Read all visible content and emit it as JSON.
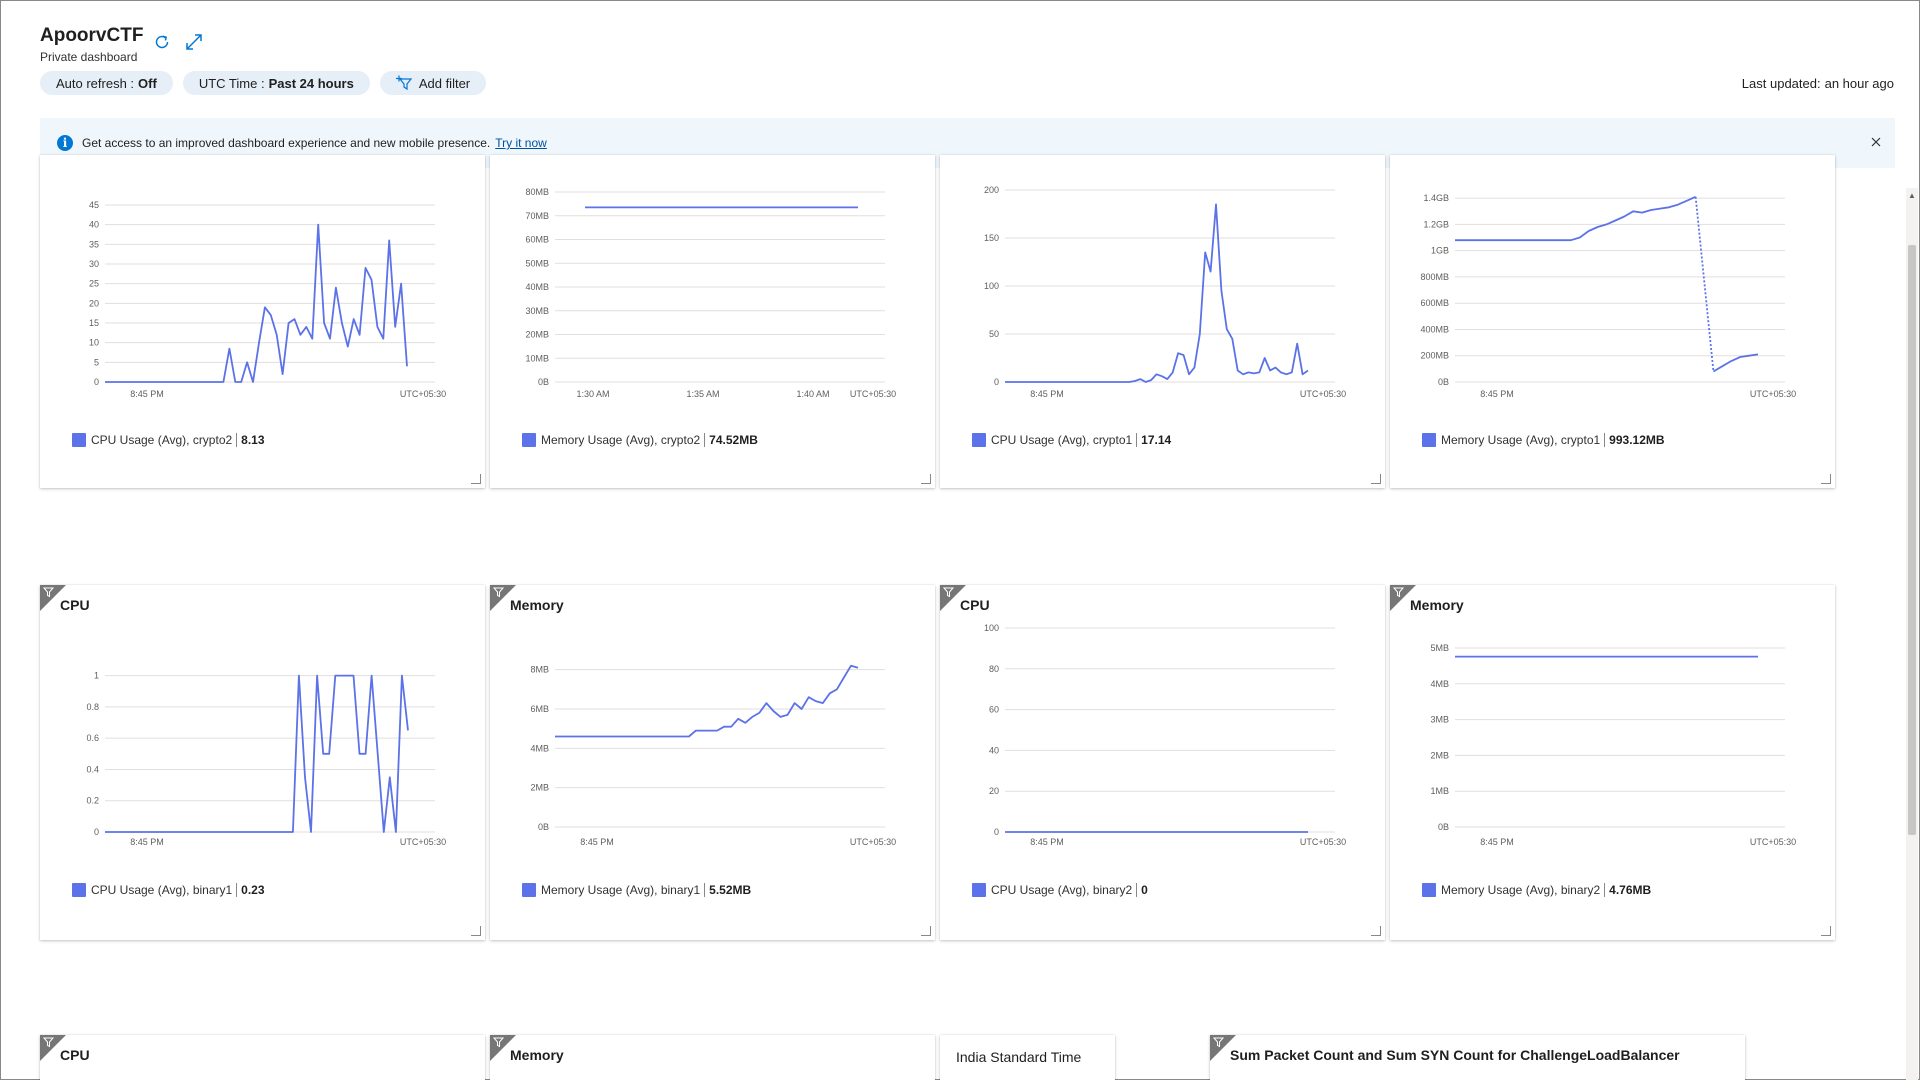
{
  "header": {
    "title": "ApoorvCTF",
    "subtitle": "Private dashboard",
    "refresh_icon": "refresh-icon",
    "expand_icon": "expand-icon",
    "auto_refresh_label": "Auto refresh :",
    "auto_refresh_value": "Off",
    "time_label": "UTC Time :",
    "time_value": "Past 24 hours",
    "add_filter_label": "Add filter",
    "last_updated_label": "Last updated:",
    "last_updated_value": "an hour ago"
  },
  "banner": {
    "icon": "info-icon",
    "message": "Get access to an improved dashboard experience and new mobile presence.",
    "link": "Try it now",
    "close_icon": "close-icon"
  },
  "colors": {
    "series": "#5b72e8",
    "accent": "#0078d4",
    "banner_bg": "#eff6fc",
    "pill_bg": "#e6eef8"
  },
  "tiles": [
    {
      "id": "t1",
      "title": "",
      "has_flag": false,
      "legend_label": "CPU Usage (Avg), crypto2",
      "legend_value": "8.13",
      "chart_data": {
        "type": "line",
        "y_ticks": [
          "0",
          "5",
          "10",
          "15",
          "20",
          "25",
          "30",
          "35",
          "40",
          "45"
        ],
        "ylim": [
          0,
          45
        ],
        "x_ticks": [
          "8:45 PM"
        ],
        "x_right_label": "UTC+05:30",
        "values": [
          0,
          0,
          0,
          0,
          0,
          0,
          0,
          0,
          0,
          0,
          0,
          0,
          0,
          0,
          0,
          0,
          0,
          0,
          0,
          0,
          0,
          8.5,
          0,
          0,
          5,
          0,
          10,
          19,
          17,
          12,
          2,
          15,
          16,
          12,
          14,
          11,
          40,
          15,
          11,
          24,
          15,
          9,
          16,
          12,
          29,
          26,
          14,
          11,
          36,
          14,
          25,
          4
        ]
      }
    },
    {
      "id": "t2",
      "title": "",
      "has_flag": false,
      "legend_label": "Memory Usage (Avg), crypto2",
      "legend_value": "74.52MB",
      "chart_data": {
        "type": "line",
        "y_ticks": [
          "0B",
          "10MB",
          "20MB",
          "30MB",
          "40MB",
          "50MB",
          "60MB",
          "70MB",
          "80MB"
        ],
        "ylim": [
          0,
          80
        ],
        "x_ticks": [
          "1:30 AM",
          "1:35 AM",
          "1:40 AM"
        ],
        "x_right_label": "UTC+05:30",
        "values": [
          73.5,
          73.5,
          73.5,
          73.5,
          73.5,
          73.5,
          73.5,
          73.5,
          73.5,
          73.5
        ]
      }
    },
    {
      "id": "t3",
      "title": "",
      "has_flag": false,
      "legend_label": "CPU Usage (Avg), crypto1",
      "legend_value": "17.14",
      "chart_data": {
        "type": "line",
        "y_ticks": [
          "0",
          "50",
          "100",
          "150",
          "200"
        ],
        "ylim": [
          0,
          200
        ],
        "x_ticks": [
          "8:45 PM"
        ],
        "x_right_label": "UTC+05:30",
        "values": [
          0,
          0,
          0,
          0,
          0,
          0,
          0,
          0,
          0,
          0,
          0,
          0,
          0,
          0,
          0,
          0,
          0,
          0,
          0,
          0,
          0,
          0,
          0,
          0,
          1,
          3,
          0,
          2,
          8,
          6,
          3,
          10,
          30,
          28,
          8,
          15,
          50,
          135,
          115,
          185,
          95,
          55,
          45,
          12,
          8,
          10,
          9,
          10,
          25,
          12,
          15,
          10,
          8,
          10,
          40,
          8,
          12
        ]
      }
    },
    {
      "id": "t4",
      "title": "",
      "has_flag": false,
      "legend_label": "Memory Usage (Avg), crypto1",
      "legend_value": "993.12MB",
      "chart_data": {
        "type": "line",
        "y_ticks": [
          "0B",
          "200MB",
          "400MB",
          "600MB",
          "800MB",
          "1GB",
          "1.2GB",
          "1.4GB"
        ],
        "ylim": [
          0,
          1500
        ],
        "x_ticks": [
          "8:45 PM"
        ],
        "x_right_label": "UTC+05:30",
        "values": [
          1080,
          1080,
          1080,
          1080,
          1080,
          1080,
          1080,
          1080,
          1080,
          1080,
          1080,
          1080,
          1080,
          1080,
          1100,
          1150,
          1180,
          1200,
          1230,
          1260,
          1300,
          1290,
          1310,
          1320,
          1330,
          1350,
          1380,
          1410
        ],
        "values_after_gap": [
          80,
          120,
          160,
          190,
          200,
          210
        ]
      }
    },
    {
      "id": "t5",
      "title": "CPU",
      "has_flag": true,
      "legend_label": "CPU Usage (Avg), binary1",
      "legend_value": "0.23",
      "chart_data": {
        "type": "line",
        "y_ticks": [
          "0",
          "0.2",
          "0.4",
          "0.6",
          "0.8",
          "1"
        ],
        "ylim": [
          0,
          1.1
        ],
        "x_ticks": [
          "8:45 PM"
        ],
        "x_right_label": "UTC+05:30",
        "values": [
          0,
          0,
          0,
          0,
          0,
          0,
          0,
          0,
          0,
          0,
          0,
          0,
          0,
          0,
          0,
          0,
          0,
          0,
          0,
          0,
          0,
          0,
          0,
          0,
          0,
          0,
          0,
          0,
          0,
          0,
          0,
          0,
          1,
          0.35,
          0,
          1,
          0.5,
          0.5,
          1,
          1,
          1,
          1,
          0.5,
          0.5,
          1,
          0.5,
          0,
          0.35,
          0,
          1,
          0.65
        ]
      }
    },
    {
      "id": "t6",
      "title": "Memory",
      "has_flag": true,
      "legend_label": "Memory Usage (Avg), binary1",
      "legend_value": "5.52MB",
      "chart_data": {
        "type": "line",
        "y_ticks": [
          "0B",
          "2MB",
          "4MB",
          "6MB",
          "8MB"
        ],
        "ylim": [
          0,
          9
        ],
        "x_ticks": [
          "8:45 PM"
        ],
        "x_right_label": "UTC+05:30",
        "values": [
          4.6,
          4.6,
          4.6,
          4.6,
          4.6,
          4.6,
          4.6,
          4.6,
          4.6,
          4.6,
          4.6,
          4.6,
          4.6,
          4.6,
          4.6,
          4.6,
          4.6,
          4.6,
          4.6,
          4.6,
          4.9,
          4.9,
          4.9,
          4.9,
          5.1,
          5.1,
          5.5,
          5.3,
          5.6,
          5.8,
          6.3,
          5.9,
          5.6,
          5.7,
          6.3,
          6.0,
          6.6,
          6.4,
          6.3,
          6.8,
          7.0,
          7.6,
          8.2,
          8.1
        ]
      }
    },
    {
      "id": "t7",
      "title": "CPU",
      "has_flag": true,
      "legend_label": "CPU Usage (Avg), binary2",
      "legend_value": "0",
      "chart_data": {
        "type": "line",
        "y_ticks": [
          "0",
          "20",
          "40",
          "60",
          "80",
          "100"
        ],
        "ylim": [
          0,
          100
        ],
        "x_ticks": [
          "8:45 PM"
        ],
        "x_right_label": "UTC+05:30",
        "values": [
          0,
          0,
          0,
          0,
          0,
          0,
          0,
          0,
          0,
          0
        ]
      }
    },
    {
      "id": "t8",
      "title": "Memory",
      "has_flag": true,
      "legend_label": "Memory Usage (Avg), binary2",
      "legend_value": "4.76MB",
      "chart_data": {
        "type": "line",
        "y_ticks": [
          "0B",
          "1MB",
          "2MB",
          "3MB",
          "4MB",
          "5MB"
        ],
        "ylim": [
          0,
          5
        ],
        "x_ticks": [
          "8:45 PM"
        ],
        "x_right_label": "UTC+05:30",
        "values": [
          4.76,
          4.76,
          4.76,
          4.76,
          4.76,
          4.76,
          4.76,
          4.76,
          4.76,
          4.76
        ]
      }
    }
  ],
  "bottom_tiles": {
    "cpu_title": "CPU",
    "memory_title": "Memory",
    "timezone_title": "India Standard Time",
    "lb_title": "Sum Packet Count and Sum SYN Count for ChallengeLoadBalancer"
  }
}
